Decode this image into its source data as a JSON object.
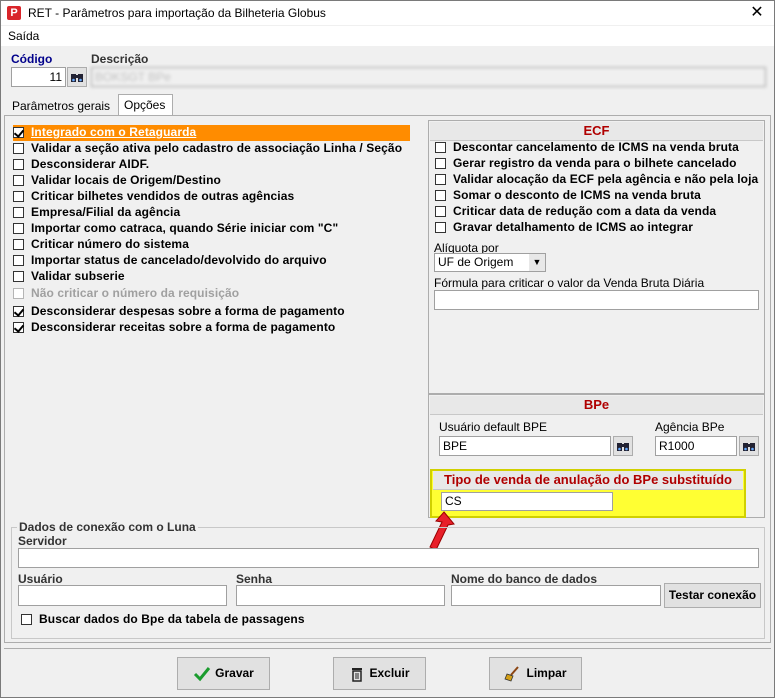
{
  "window": {
    "title": "RET - Parâmetros para importação da Bilheteria Globus",
    "close_glyph": "✕"
  },
  "menu": {
    "exit_label": "Saída"
  },
  "header": {
    "code_label": "Código",
    "code_value": "11",
    "description_label": "Descrição",
    "description_value": "BOKSGT BPe"
  },
  "tabs": [
    {
      "label": "Parâmetros gerais"
    },
    {
      "label": "Opções"
    }
  ],
  "options": [
    {
      "label": "Integrado com o Retaguarda",
      "checked": true,
      "highlighted": true
    },
    {
      "label": "Validar a seção ativa pelo cadastro de associação Linha / Seção",
      "checked": false
    },
    {
      "label": "Desconsiderar AIDF.",
      "checked": false
    },
    {
      "label": "Validar locais de Origem/Destino",
      "checked": false
    },
    {
      "label": "Criticar bilhetes vendidos de outras agências",
      "checked": false
    },
    {
      "label": "Empresa/Filial da agência",
      "checked": false
    },
    {
      "label": "Importar como catraca, quando Série iniciar com \"C\"",
      "checked": false
    },
    {
      "label": "Criticar número do sistema",
      "checked": false
    },
    {
      "label": "Importar status de cancelado/devolvido do arquivo",
      "checked": false
    },
    {
      "label": "Validar subserie",
      "checked": false
    },
    {
      "label": "Não criticar o número da requisição",
      "checked": false,
      "disabled": true
    },
    {
      "label": "Desconsiderar despesas sobre a forma de pagamento",
      "checked": true
    },
    {
      "label": "Desconsiderar receitas sobre a forma de pagamento",
      "checked": true
    }
  ],
  "ecf": {
    "title": "ECF",
    "options": [
      {
        "label": "Descontar cancelamento de ICMS na venda bruta",
        "checked": false
      },
      {
        "label": "Gerar registro da venda para o bilhete cancelado",
        "checked": false
      },
      {
        "label": "Validar alocação da ECF pela agência e não pela loja",
        "checked": false
      },
      {
        "label": "Somar o desconto de ICMS na venda bruta",
        "checked": false
      },
      {
        "label": "Criticar data de redução com a data da venda",
        "checked": false
      },
      {
        "label": "Gravar detalhamento de ICMS ao integrar",
        "checked": false
      }
    ],
    "aliquota_label": "Alíquota por",
    "aliquota_value": "UF de Origem",
    "formula_label": "Fórmula para criticar o valor da Venda Bruta Diária",
    "formula_value": ""
  },
  "bpe": {
    "title": "BPe",
    "user_label": "Usuário default BPE",
    "user_value": "BPE",
    "agency_label": "Agência BPe",
    "agency_value": "R1000",
    "annul_title": "Tipo de venda de anulação do BPe substituído",
    "annul_value": "CS"
  },
  "luna": {
    "title": "Dados de conexão com o Luna",
    "server_label": "Servidor",
    "server_value": "",
    "user_label": "Usuário",
    "user_value": "",
    "password_label": "Senha",
    "password_value": "",
    "db_label": "Nome do banco de dados",
    "db_value": "",
    "test_button": "Testar conexão",
    "fetch_label": "Buscar dados do Bpe da tabela de passagens",
    "fetch_checked": false
  },
  "footer": {
    "save_label": "Gravar",
    "delete_label": "Excluir",
    "clear_label": "Limpar"
  },
  "colors": {
    "highlight": "#ff8c00",
    "section_title": "#b00000",
    "annotation_yellow": "#ffff33",
    "arrow": "#e8202a"
  }
}
